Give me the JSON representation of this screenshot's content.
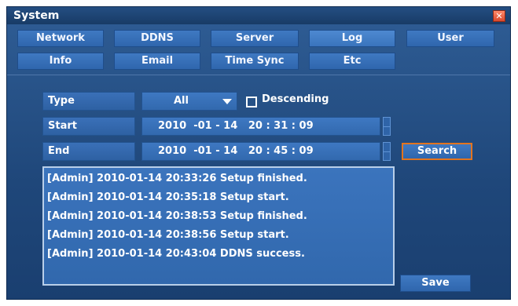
{
  "window": {
    "title": "System",
    "close_label": "✕"
  },
  "tabs": [
    {
      "label": "Network"
    },
    {
      "label": "DDNS"
    },
    {
      "label": "Server"
    },
    {
      "label": "Log",
      "active": true
    },
    {
      "label": "User"
    },
    {
      "label": "Info"
    },
    {
      "label": "Email"
    },
    {
      "label": "Time Sync"
    },
    {
      "label": "Etc"
    }
  ],
  "form": {
    "type_label": "Type",
    "type_value": "All",
    "descending_label": "Descending",
    "descending_checked": false,
    "start_label": "Start",
    "start_value": "2010  -01 - 14   20 : 31 : 09",
    "end_label": "End",
    "end_value": "2010  -01 - 14   20 : 45 : 09",
    "search_label": "Search"
  },
  "log": {
    "entries": [
      "[Admin] 2010-01-14 20:33:26 Setup finished.",
      "[Admin] 2010-01-14 20:35:18 Setup start.",
      "[Admin] 2010-01-14 20:38:53 Setup finished.",
      "[Admin] 2010-01-14 20:38:56 Setup start.",
      "[Admin] 2010-01-14 20:43:04 DDNS success."
    ]
  },
  "actions": {
    "save_label": "Save"
  },
  "colors": {
    "panel": "#1f477a",
    "button": "#3f79c2",
    "search_outline": "#e2741f"
  },
  "icons": {
    "close": "close-icon",
    "dropdown": "chevron-down-icon",
    "checkbox": "checkbox-icon",
    "spin": "spinner-icon"
  }
}
